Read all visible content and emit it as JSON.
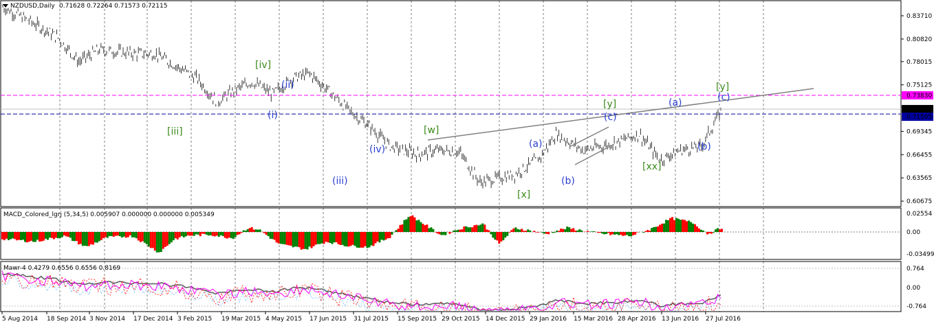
{
  "main": {
    "title": "NZDUSD,Daily",
    "ohlc": "0.71628 0.72264 0.71573 0.72115",
    "yticks": [
      "0.83710",
      "0.80820",
      "0.78015",
      "0.75125",
      "0.72115",
      "0.71505",
      "0.69345",
      "0.66455",
      "0.63565",
      "0.60675"
    ],
    "level_magenta": "0.73830",
    "level_current": "0.72115",
    "level_blue": "0.71505"
  },
  "macd": {
    "title": "MACD_Colored_lgrj (5,34,5) 0.005907 0.000000 0.000000 0.005349",
    "yticks": [
      "0.02554",
      "0.00",
      "-0.034998"
    ]
  },
  "mawr": {
    "title": "Mawr-4 0.4279 0.6556 0.6556 0.8169",
    "yticks": [
      "0.764",
      "0.00",
      "-0.764"
    ]
  },
  "xaxis": [
    "5 Aug 2014",
    "18 Sep 2014",
    "3 Nov 2014",
    "17 Dec 2014",
    "3 Feb 2015",
    "19 Mar 2015",
    "4 May 2015",
    "17 Jun 2015",
    "31 Jul 2015",
    "15 Sep 2015",
    "29 Oct 2015",
    "14 Dec 2015",
    "29 Jan 2016",
    "15 Mar 2016",
    "28 Apr 2016",
    "13 Jun 2016",
    "27 Jul 2016"
  ],
  "waves_green": [
    "[iv]",
    "[iii]",
    "[w]",
    "[x]",
    "[y]",
    "[xx]",
    "[y]"
  ],
  "waves_blue": [
    "(ii)",
    "(i)",
    "(iv)",
    "(iii)",
    "(a)",
    "(b)",
    "(c)",
    "(a)",
    "(b)",
    "(c)"
  ],
  "colors": {
    "up": "#008000",
    "down": "#ff0000",
    "magenta": "#ff00ff",
    "blue": "#0000a0",
    "trend": "#808080",
    "green_text": "#3a8a1a",
    "blue_text": "#2a3fd0"
  },
  "chart_data": {
    "type": "candlestick",
    "symbol": "NZDUSD",
    "timeframe": "Daily",
    "ohlc_last": {
      "open": 0.71628,
      "high": 0.72264,
      "low": 0.71573,
      "close": 0.72115
    },
    "ylim": [
      0.60675,
      0.85
    ],
    "approx_close_path": [
      {
        "date": "5 Aug 2014",
        "close": 0.848
      },
      {
        "date": "18 Sep 2014",
        "close": 0.818
      },
      {
        "date": "3 Nov 2014",
        "close": 0.79
      },
      {
        "date": "17 Dec 2014",
        "close": 0.775
      },
      {
        "date": "3 Feb 2015",
        "close": 0.735
      },
      {
        "date": "19 Mar 2015",
        "close": 0.75
      },
      {
        "date": "4 May 2015",
        "close": 0.752
      },
      {
        "date": "17 Jun 2015",
        "close": 0.695
      },
      {
        "date": "31 Jul 2015",
        "close": 0.66
      },
      {
        "date": "15 Sep 2015",
        "close": 0.64
      },
      {
        "date": "29 Oct 2015",
        "close": 0.68
      },
      {
        "date": "14 Dec 2015",
        "close": 0.665
      },
      {
        "date": "29 Jan 2016",
        "close": 0.655
      },
      {
        "date": "15 Mar 2016",
        "close": 0.675
      },
      {
        "date": "28 Apr 2016",
        "close": 0.69
      },
      {
        "date": "13 Jun 2016",
        "close": 0.71
      },
      {
        "date": "27 Jul 2016",
        "close": 0.72115
      }
    ]
  }
}
